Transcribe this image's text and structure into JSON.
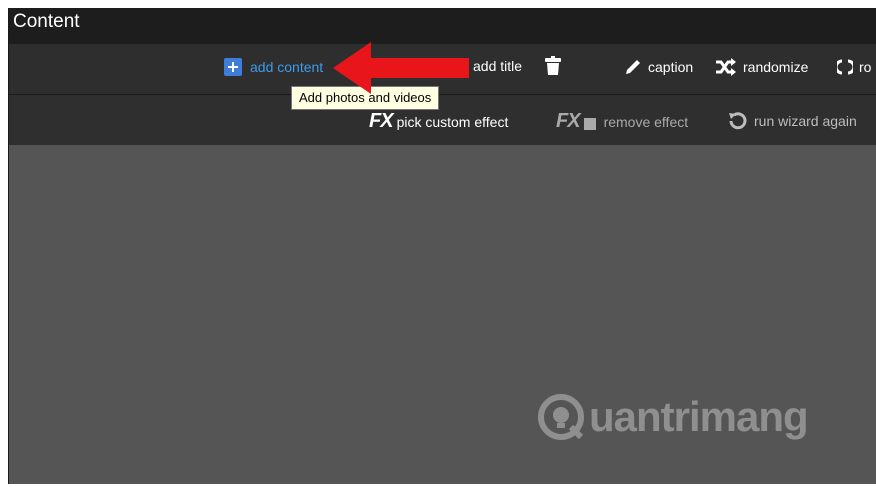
{
  "window": {
    "title": "Content"
  },
  "toolbar_primary": {
    "add_content_label": "add content",
    "add_title_label": "add title",
    "caption_label": "caption",
    "randomize_label": "randomize",
    "rotate_label": "ro"
  },
  "toolbar_secondary": {
    "pick_effect_label": "pick custom effect",
    "remove_effect_label": "remove effect",
    "wizard_label": "run wizard again"
  },
  "tooltip": {
    "text": "Add photos and videos"
  },
  "watermark": {
    "text": "uantrimang"
  },
  "colors": {
    "accent": "#3d9be9",
    "annotation_arrow": "#e8151b",
    "tooltip_bg": "#ffffe1"
  }
}
